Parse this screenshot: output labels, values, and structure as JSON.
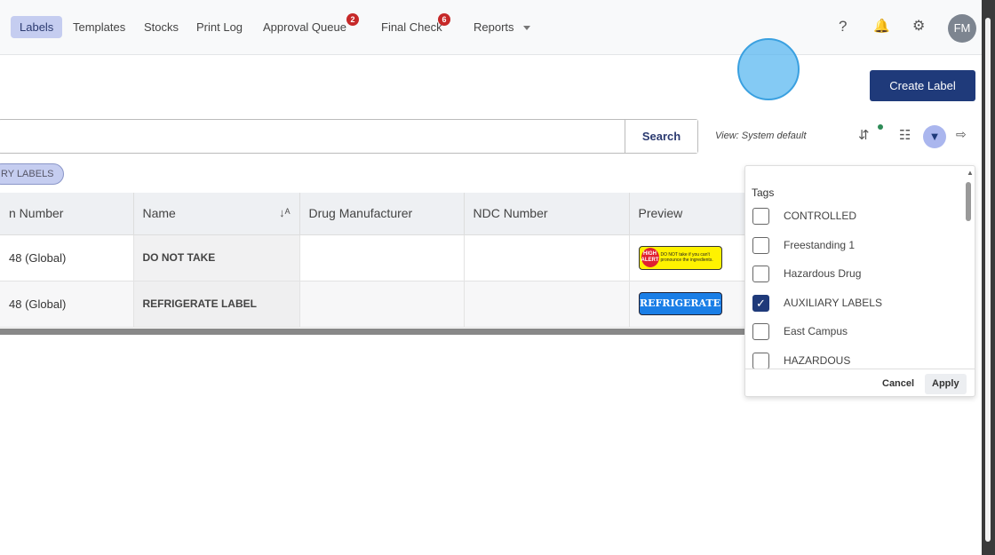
{
  "nav": {
    "items": [
      {
        "label": "Labels"
      },
      {
        "label": "Templates"
      },
      {
        "label": "Stocks"
      },
      {
        "label": "Print Log"
      },
      {
        "label": "Approval Queue",
        "badge": "2"
      },
      {
        "label": "Final Check",
        "badge": "6"
      },
      {
        "label": "Reports"
      }
    ],
    "avatar": "FM"
  },
  "actions": {
    "create": "Create Label"
  },
  "search": {
    "value": "",
    "button": "Search",
    "view": "View: System default"
  },
  "chip": "RY LABELS",
  "table": {
    "headers": [
      "n Number",
      "Name",
      "Drug Manufacturer",
      "NDC Number",
      "Preview"
    ],
    "rows": [
      {
        "number": "48 (Global)",
        "name": "DO NOT TAKE",
        "manufacturer": "",
        "ndc": "",
        "preview_text": "DO NOT take if you can't pronounce the ingredients.",
        "preview_badge": "HIGH ALERT"
      },
      {
        "number": "48 (Global)",
        "name": "REFRIGERATE LABEL",
        "manufacturer": "",
        "ndc": "",
        "preview_text": "REFRIGERATE"
      }
    ]
  },
  "filter": {
    "title": "Tags",
    "options": [
      {
        "label": "CONTROLLED",
        "checked": false
      },
      {
        "label": "Freestanding 1",
        "checked": false
      },
      {
        "label": "Hazardous Drug",
        "checked": false
      },
      {
        "label": "AUXILIARY LABELS",
        "checked": true
      },
      {
        "label": "East Campus",
        "checked": false
      },
      {
        "label": "HAZARDOUS",
        "checked": false
      }
    ],
    "cancel": "Cancel",
    "apply": "Apply"
  },
  "colors": {
    "primary": "#1f3a7a",
    "active_nav": "#c5cdf0",
    "badge": "#c62828"
  }
}
